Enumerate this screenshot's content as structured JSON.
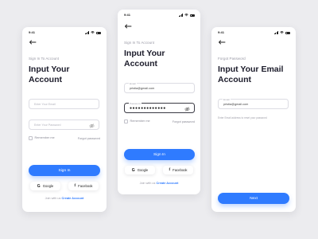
{
  "screens": [
    {
      "status_time": "9:41",
      "eyebrow": "Sign In To Account",
      "title_line1": "Input Your",
      "title_line2": "Account",
      "email_placeholder": "Enter Your Email",
      "password_placeholder": "Enter Your Password",
      "remember_label": "Remember me",
      "forgot_label": "Forgot password",
      "signin_label": "Sign In",
      "google_label": "Google",
      "facebook_label": "Facebook",
      "join_text": "Join with us",
      "join_link": "Create Account"
    },
    {
      "status_time": "9:41",
      "eyebrow": "Sign In To Account",
      "title_line1": "Input Your",
      "title_line2": "Account",
      "email_label": "Email",
      "email_value": "pristia@gmail.com",
      "password_label": "Password",
      "password_dots": "●●●●●●●●●●●●●",
      "remember_label": "Remember me",
      "forgot_label": "Forgot password",
      "signin_label": "Sign In",
      "google_label": "Google",
      "facebook_label": "Facebook",
      "join_text": "Join with us",
      "join_link": "Create Account"
    },
    {
      "status_time": "9:41",
      "eyebrow": "Forgot Password",
      "title_line1": "Input Your Email",
      "title_line2": "Account",
      "email_label": "Email",
      "email_value": "pristia@gmail.com",
      "hint": "Enter Email address to reset your password",
      "next_label": "Next"
    }
  ],
  "colors": {
    "primary": "#2f7bff",
    "background": "#ececef",
    "text": "#1b1b2a"
  }
}
